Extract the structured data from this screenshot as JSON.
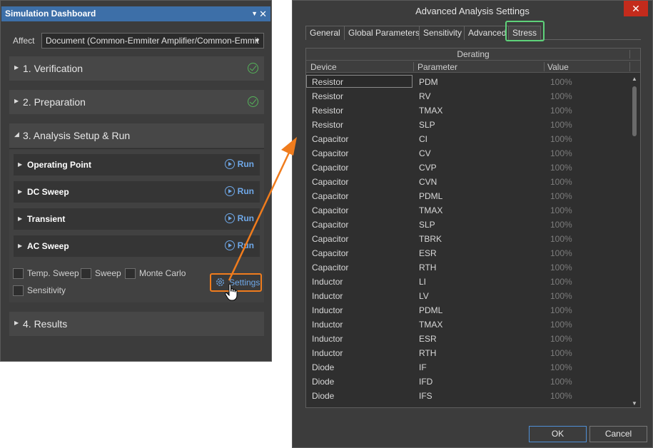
{
  "sim_panel": {
    "title": "Simulation Dashboard",
    "pin_glyph": "▼",
    "close_glyph": "✕",
    "affect_label": "Affect",
    "affect_value": "Document (Common-Emmiter Amplifier/Common-Emmit",
    "sections": {
      "verification": "1. Verification",
      "preparation": "2. Preparation",
      "analysis": "3. Analysis Setup & Run",
      "results": "4. Results"
    },
    "analyses": [
      {
        "name": "Operating Point",
        "run": "Run"
      },
      {
        "name": "DC Sweep",
        "run": "Run"
      },
      {
        "name": "Transient",
        "run": "Run"
      },
      {
        "name": "AC Sweep",
        "run": "Run"
      }
    ],
    "options": {
      "temp_sweep": "Temp. Sweep",
      "sweep": "Sweep",
      "monte_carlo": "Monte Carlo",
      "sensitivity": "Sensitivity"
    },
    "settings_label": "Settings"
  },
  "dialog": {
    "title": "Advanced Analysis Settings",
    "close_glyph": "✕",
    "tabs": [
      "General",
      "Global Parameters",
      "Sensitivity",
      "Advanced",
      "Stress"
    ],
    "active_tab": "Stress",
    "grid_band": "Derating",
    "columns": {
      "device": "Device",
      "parameter": "Parameter",
      "value": "Value"
    },
    "rows": [
      {
        "device": "Resistor",
        "parameter": "PDM",
        "value": "100%"
      },
      {
        "device": "Resistor",
        "parameter": "RV",
        "value": "100%"
      },
      {
        "device": "Resistor",
        "parameter": "TMAX",
        "value": "100%"
      },
      {
        "device": "Resistor",
        "parameter": "SLP",
        "value": "100%"
      },
      {
        "device": "Capacitor",
        "parameter": "CI",
        "value": "100%"
      },
      {
        "device": "Capacitor",
        "parameter": "CV",
        "value": "100%"
      },
      {
        "device": "Capacitor",
        "parameter": "CVP",
        "value": "100%"
      },
      {
        "device": "Capacitor",
        "parameter": "CVN",
        "value": "100%"
      },
      {
        "device": "Capacitor",
        "parameter": "PDML",
        "value": "100%"
      },
      {
        "device": "Capacitor",
        "parameter": "TMAX",
        "value": "100%"
      },
      {
        "device": "Capacitor",
        "parameter": "SLP",
        "value": "100%"
      },
      {
        "device": "Capacitor",
        "parameter": "TBRK",
        "value": "100%"
      },
      {
        "device": "Capacitor",
        "parameter": "ESR",
        "value": "100%"
      },
      {
        "device": "Capacitor",
        "parameter": "RTH",
        "value": "100%"
      },
      {
        "device": "Inductor",
        "parameter": "LI",
        "value": "100%"
      },
      {
        "device": "Inductor",
        "parameter": "LV",
        "value": "100%"
      },
      {
        "device": "Inductor",
        "parameter": "PDML",
        "value": "100%"
      },
      {
        "device": "Inductor",
        "parameter": "TMAX",
        "value": "100%"
      },
      {
        "device": "Inductor",
        "parameter": "ESR",
        "value": "100%"
      },
      {
        "device": "Inductor",
        "parameter": "RTH",
        "value": "100%"
      },
      {
        "device": "Diode",
        "parameter": "IF",
        "value": "100%"
      },
      {
        "device": "Diode",
        "parameter": "IFD",
        "value": "100%"
      },
      {
        "device": "Diode",
        "parameter": "IFS",
        "value": "100%"
      }
    ],
    "ok_label": "OK",
    "cancel_label": "Cancel"
  },
  "colors": {
    "highlight_orange": "#f07c1d",
    "highlight_green": "#5ed27a",
    "link_blue": "#6fa8e8",
    "check_green": "#55b35a"
  }
}
